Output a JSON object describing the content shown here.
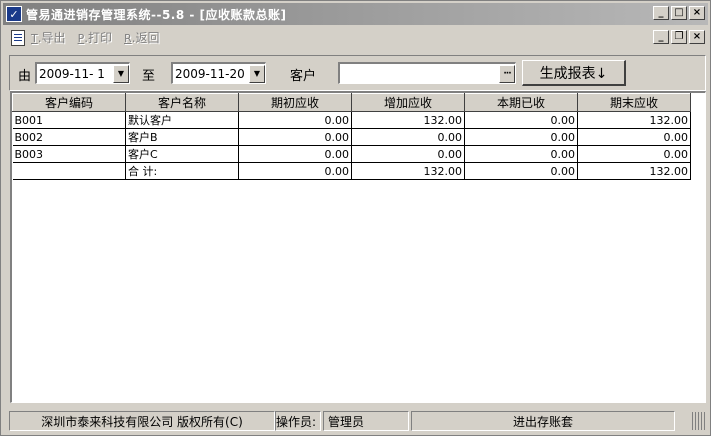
{
  "window": {
    "title": "管易通进销存管理系统--5.8 - [应收账款总账]",
    "app_icon_glyph": "✓",
    "controls": {
      "minimize": "_",
      "maximize": "□",
      "close": "×",
      "restore": "❐"
    }
  },
  "menu": [
    {
      "key": "T",
      "label": ".导出"
    },
    {
      "key": "P",
      "label": ".打印"
    },
    {
      "key": "R",
      "label": ".返回"
    }
  ],
  "filter": {
    "from_label": "由",
    "from_date": "2009-11- 1",
    "to_label": "至",
    "to_date": "2009-11-20",
    "customer_label": "客户",
    "customer_value": "",
    "ellipsis": "···",
    "generate_label": "生成报表↓"
  },
  "table": {
    "columns": [
      "客户编码",
      "客户名称",
      "期初应收",
      "增加应收",
      "本期已收",
      "期末应收"
    ],
    "rows": [
      [
        "B001",
        "默认客户",
        "0.00",
        "132.00",
        "0.00",
        "132.00"
      ],
      [
        "B002",
        "客户B",
        "0.00",
        "0.00",
        "0.00",
        "0.00"
      ],
      [
        "B003",
        "客户C",
        "0.00",
        "0.00",
        "0.00",
        "0.00"
      ],
      [
        "",
        "合 计:",
        "0.00",
        "132.00",
        "0.00",
        "132.00"
      ]
    ]
  },
  "status": {
    "company": "深圳市泰来科技有限公司 版权所有(C)",
    "operator_label": "操作员:",
    "operator": "管理员",
    "account_set": "进出存账套"
  },
  "colors": {
    "title_gradient_start": "#808080",
    "title_gradient_end": "#b8b8b8",
    "face": "#d4d0c8"
  }
}
